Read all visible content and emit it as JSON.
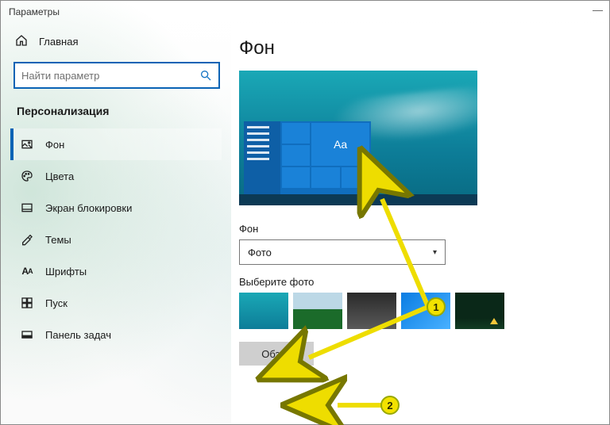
{
  "window": {
    "title": "Параметры"
  },
  "sidebar": {
    "home": "Главная",
    "search_placeholder": "Найти параметр",
    "section": "Персонализация",
    "items": [
      {
        "label": "Фон"
      },
      {
        "label": "Цвета"
      },
      {
        "label": "Экран блокировки"
      },
      {
        "label": "Темы"
      },
      {
        "label": "Шрифты"
      },
      {
        "label": "Пуск"
      },
      {
        "label": "Панель задач"
      }
    ]
  },
  "content": {
    "heading": "Фон",
    "preview_tile_text": "Aa",
    "bg_label": "Фон",
    "bg_dropdown_value": "Фото",
    "choose_label": "Выберите фото",
    "browse_label": "Обзор"
  },
  "annotations": {
    "badge1": "1",
    "badge2": "2"
  },
  "colors": {
    "accent": "#0a63b5"
  }
}
